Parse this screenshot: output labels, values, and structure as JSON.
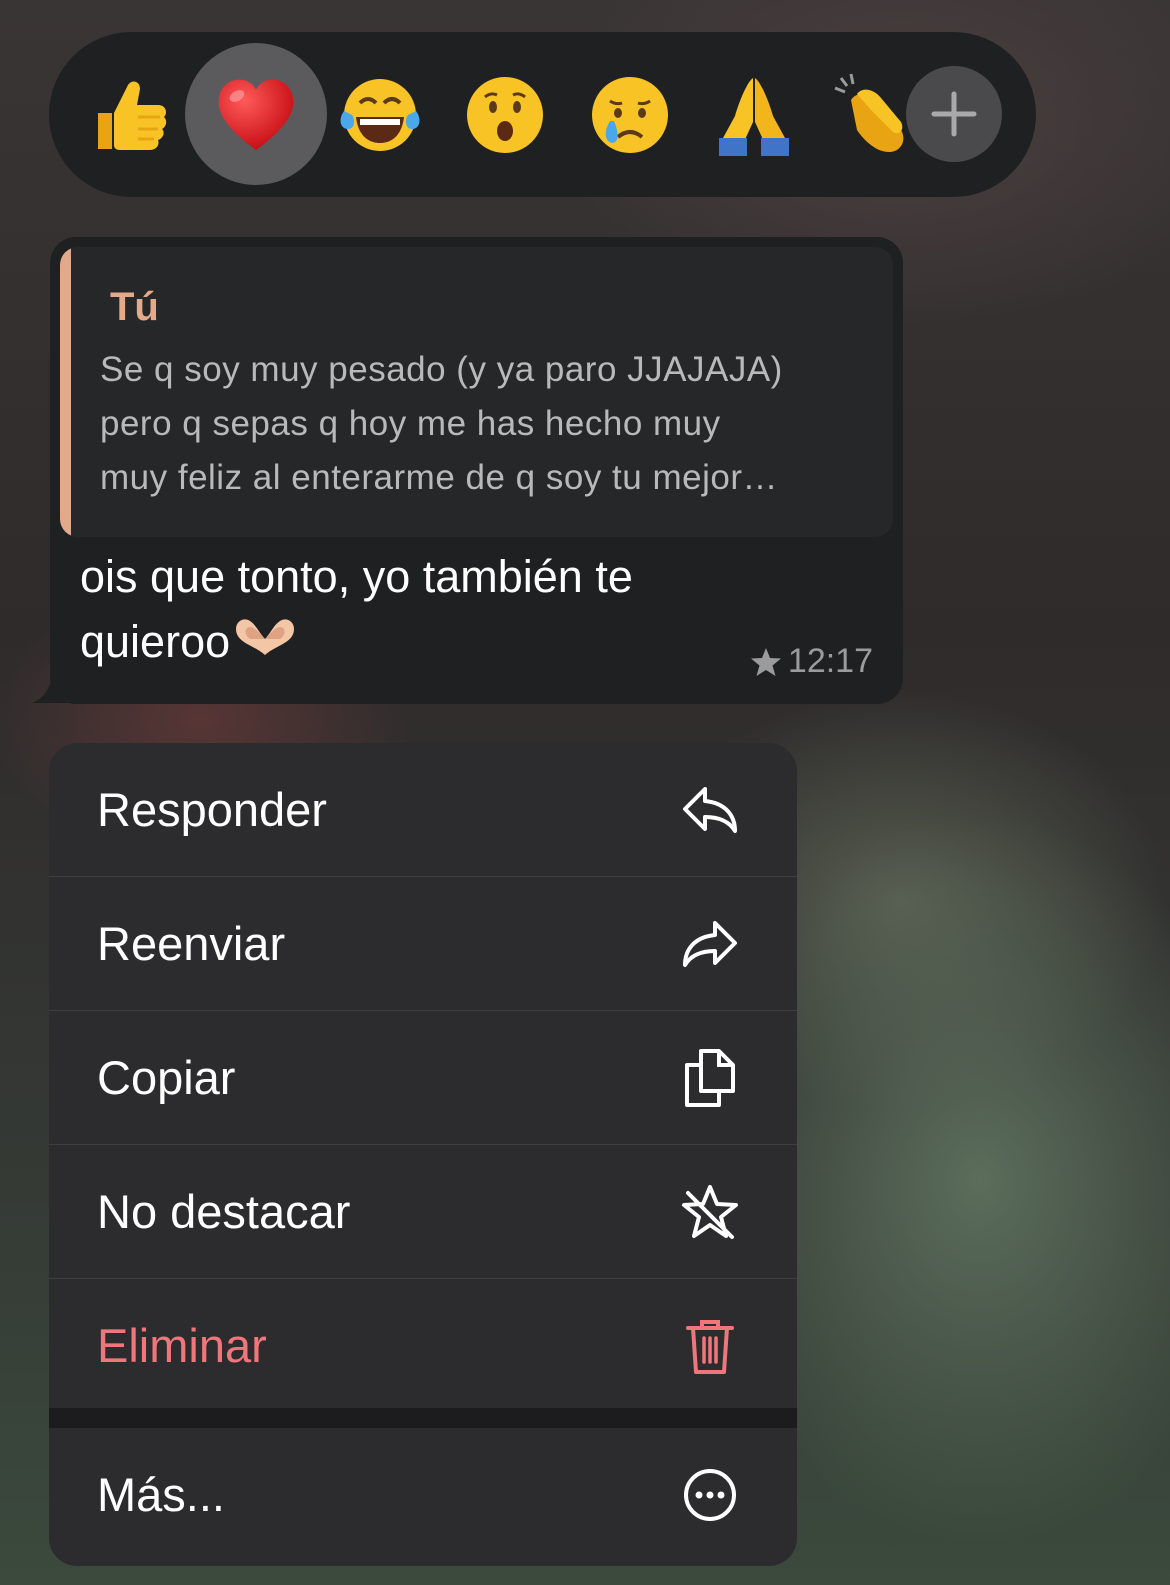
{
  "reactions": {
    "emojis": [
      {
        "name": "thumbs-up",
        "glyph": "👍"
      },
      {
        "name": "red-heart",
        "glyph": "❤️",
        "selected": true
      },
      {
        "name": "tears-of-joy",
        "glyph": "😂"
      },
      {
        "name": "surprised",
        "glyph": "😮"
      },
      {
        "name": "crying",
        "glyph": "😢"
      },
      {
        "name": "folded-hands",
        "glyph": "🙏"
      },
      {
        "name": "clapping-hands",
        "glyph": "👏"
      }
    ],
    "more_icon": "plus-icon"
  },
  "message": {
    "quote": {
      "author": "Tú",
      "lines": [
        "Se q soy muy pesado (y ya paro JJAJAJA)",
        "pero q sepas q hoy me has hecho muy",
        "muy feliz al enterarme de q soy tu mejor…"
      ]
    },
    "text_line1": "ois que tonto, yo también te",
    "text_line2": "quieroo",
    "time": "12:17",
    "starred": true
  },
  "menu": {
    "items": [
      {
        "label": "Responder",
        "icon": "reply-icon"
      },
      {
        "label": "Reenviar",
        "icon": "forward-icon"
      },
      {
        "label": "Copiar",
        "icon": "copy-icon"
      },
      {
        "label": "No destacar",
        "icon": "unstar-icon"
      },
      {
        "label": "Eliminar",
        "icon": "trash-icon"
      },
      {
        "label": "Más...",
        "icon": "more-icon"
      }
    ]
  },
  "colors": {
    "accent_quote": "#e2a98b",
    "danger": "#f1767b"
  }
}
